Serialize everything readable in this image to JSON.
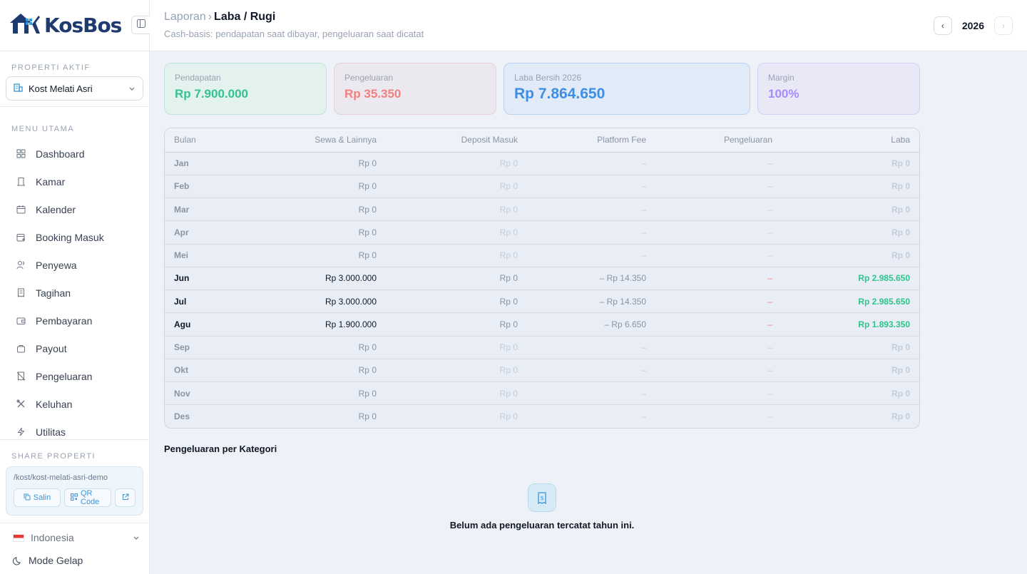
{
  "brand": {
    "name": "KosBos",
    "logo_icon": "house-key-icon"
  },
  "sidebar": {
    "property_label": "PROPERTI AKTIF",
    "property_name": "Kost Melati Asri",
    "menu_label": "MENU UTAMA",
    "items": [
      {
        "label": "Dashboard",
        "icon": "grid-icon"
      },
      {
        "label": "Kamar",
        "icon": "door-icon"
      },
      {
        "label": "Kalender",
        "icon": "calendar-icon"
      },
      {
        "label": "Booking Masuk",
        "icon": "calendar-plus-icon"
      },
      {
        "label": "Penyewa",
        "icon": "users-icon"
      },
      {
        "label": "Tagihan",
        "icon": "receipt-icon"
      },
      {
        "label": "Pembayaran",
        "icon": "wallet-icon"
      },
      {
        "label": "Payout",
        "icon": "bag-icon"
      },
      {
        "label": "Pengeluaran",
        "icon": "receipt-off-icon"
      },
      {
        "label": "Keluhan",
        "icon": "tools-icon"
      },
      {
        "label": "Utilitas",
        "icon": "bolt-icon"
      }
    ],
    "share_label": "SHARE PROPERTI",
    "share_url": "/kost/kost-melati-asri-demo",
    "copy_label": "Salin",
    "qr_label": "QR Code",
    "language": "Indonesia",
    "dark_mode_label": "Mode Gelap"
  },
  "header": {
    "breadcrumb_parent": "Laporan",
    "breadcrumb_current": "Laba / Rugi",
    "subtitle": "Cash-basis: pendapatan saat dibayar, pengeluaran saat dicatat",
    "year": "2026",
    "prev_label": "‹",
    "next_label": "›"
  },
  "stats": {
    "pendapatan": {
      "label": "Pendapatan",
      "value": "Rp 7.900.000"
    },
    "pengeluaran": {
      "label": "Pengeluaran",
      "value": "Rp 35.350"
    },
    "laba": {
      "label": "Laba Bersih 2026",
      "value": "Rp 7.864.650"
    },
    "margin": {
      "label": "Margin",
      "value": "100%"
    }
  },
  "table": {
    "headers": [
      "Bulan",
      "Sewa & Lainnya",
      "Deposit Masuk",
      "Platform Fee",
      "Pengeluaran",
      "Laba"
    ],
    "rows": [
      {
        "month": "Jan",
        "sewa": "Rp 0",
        "deposit": "Rp 0",
        "fee": "–",
        "peng": "–",
        "laba": "Rp 0",
        "active": false
      },
      {
        "month": "Feb",
        "sewa": "Rp 0",
        "deposit": "Rp 0",
        "fee": "–",
        "peng": "–",
        "laba": "Rp 0",
        "active": false
      },
      {
        "month": "Mar",
        "sewa": "Rp 0",
        "deposit": "Rp 0",
        "fee": "–",
        "peng": "–",
        "laba": "Rp 0",
        "active": false
      },
      {
        "month": "Apr",
        "sewa": "Rp 0",
        "deposit": "Rp 0",
        "fee": "–",
        "peng": "–",
        "laba": "Rp 0",
        "active": false
      },
      {
        "month": "Mei",
        "sewa": "Rp 0",
        "deposit": "Rp 0",
        "fee": "–",
        "peng": "–",
        "laba": "Rp 0",
        "active": false
      },
      {
        "month": "Jun",
        "sewa": "Rp 3.000.000",
        "deposit": "Rp 0",
        "fee": "– Rp 14.350",
        "peng": "–",
        "laba": "Rp 2.985.650",
        "active": true
      },
      {
        "month": "Jul",
        "sewa": "Rp 3.000.000",
        "deposit": "Rp 0",
        "fee": "– Rp 14.350",
        "peng": "–",
        "laba": "Rp 2.985.650",
        "active": true
      },
      {
        "month": "Agu",
        "sewa": "Rp 1.900.000",
        "deposit": "Rp 0",
        "fee": "– Rp 6.650",
        "peng": "–",
        "laba": "Rp 1.893.350",
        "active": true
      },
      {
        "month": "Sep",
        "sewa": "Rp 0",
        "deposit": "Rp 0",
        "fee": "–",
        "peng": "–",
        "laba": "Rp 0",
        "active": false
      },
      {
        "month": "Okt",
        "sewa": "Rp 0",
        "deposit": "Rp 0",
        "fee": "–",
        "peng": "–",
        "laba": "Rp 0",
        "active": false
      },
      {
        "month": "Nov",
        "sewa": "Rp 0",
        "deposit": "Rp 0",
        "fee": "–",
        "peng": "–",
        "laba": "Rp 0",
        "active": false
      },
      {
        "month": "Des",
        "sewa": "Rp 0",
        "deposit": "Rp 0",
        "fee": "–",
        "peng": "–",
        "laba": "Rp 0",
        "active": false
      }
    ]
  },
  "category": {
    "title": "Pengeluaran per Kategori",
    "empty_text": "Belum ada pengeluaran tercatat tahun ini.",
    "empty_icon": "receipt-icon"
  },
  "colors": {
    "primary": "#3f8ee6",
    "positive": "#2ec48a",
    "negative": "#f07f7f",
    "margin": "#a78bfa",
    "brand_navy": "#1e3a6e",
    "brand_blue": "#2f9be0"
  }
}
